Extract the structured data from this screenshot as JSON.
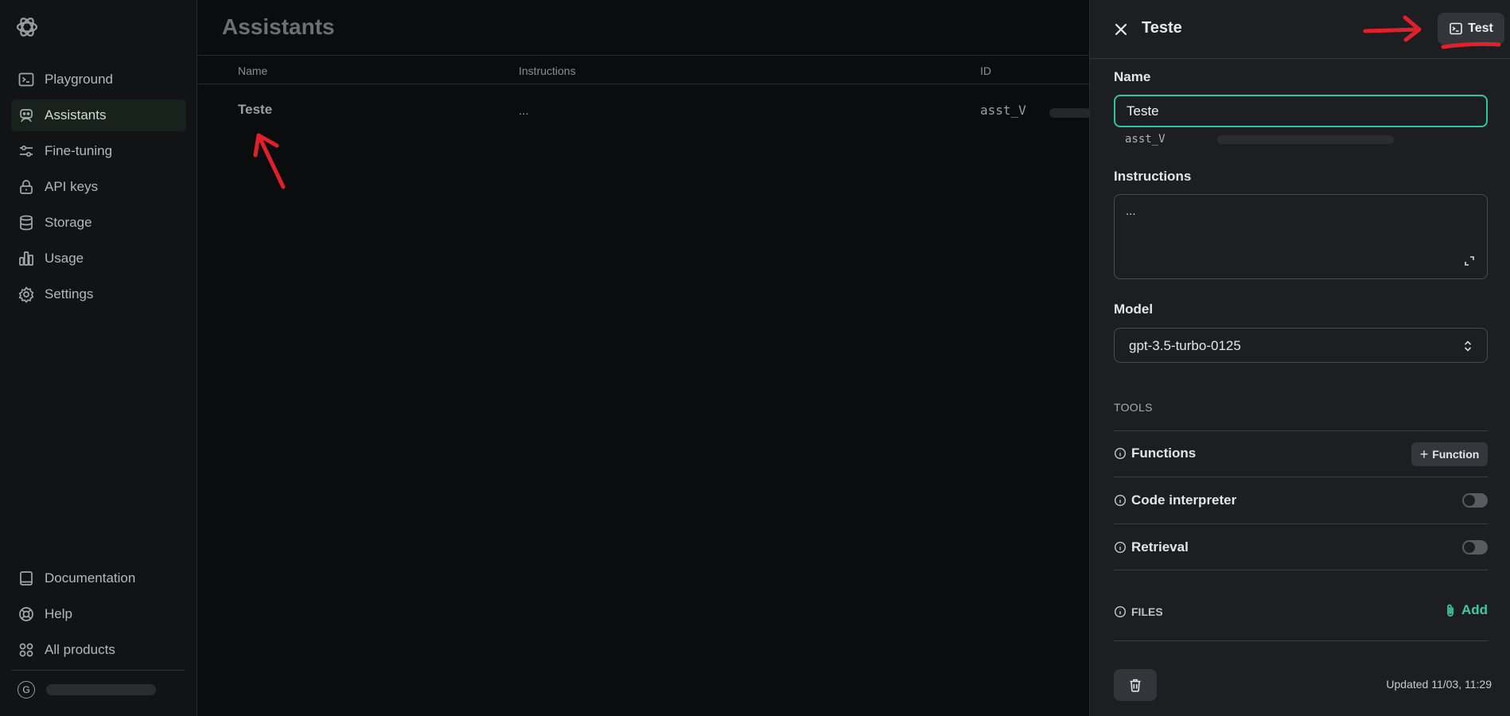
{
  "sidebar": {
    "items": [
      {
        "label": "Playground",
        "icon": "terminal-icon"
      },
      {
        "label": "Assistants",
        "icon": "robot-icon",
        "active": true
      },
      {
        "label": "Fine-tuning",
        "icon": "sliders-icon"
      },
      {
        "label": "API keys",
        "icon": "lock-icon"
      },
      {
        "label": "Storage",
        "icon": "database-icon"
      },
      {
        "label": "Usage",
        "icon": "bar-chart-icon"
      },
      {
        "label": "Settings",
        "icon": "gear-icon"
      }
    ],
    "bottom_items": [
      {
        "label": "Documentation",
        "icon": "book-icon"
      },
      {
        "label": "Help",
        "icon": "lifebuoy-icon"
      },
      {
        "label": "All products",
        "icon": "grid-icon"
      }
    ],
    "user_initial": "G"
  },
  "main": {
    "title": "Assistants",
    "columns": [
      "Name",
      "Instructions",
      "ID"
    ],
    "rows": [
      {
        "name": "Teste",
        "instructions": "...",
        "id": "asst_V"
      }
    ]
  },
  "panel": {
    "title": "Teste",
    "test_label": "Test",
    "name_label": "Name",
    "name_value": "Teste",
    "assistant_id": "asst_V",
    "instructions_label": "Instructions",
    "instructions_value": "...",
    "model_label": "Model",
    "model_value": "gpt-3.5-turbo-0125",
    "tools_label": "TOOLS",
    "tools": {
      "functions": "Functions",
      "function_button": "Function",
      "code_interpreter": "Code interpreter",
      "retrieval": "Retrieval"
    },
    "toggles": {
      "code_interpreter": false,
      "retrieval": false
    },
    "files_label": "FILES",
    "add_label": "Add",
    "updated": "Updated 11/03, 11:29"
  },
  "colors": {
    "accent": "#2ec4a4",
    "annotation": "#e0202a"
  }
}
